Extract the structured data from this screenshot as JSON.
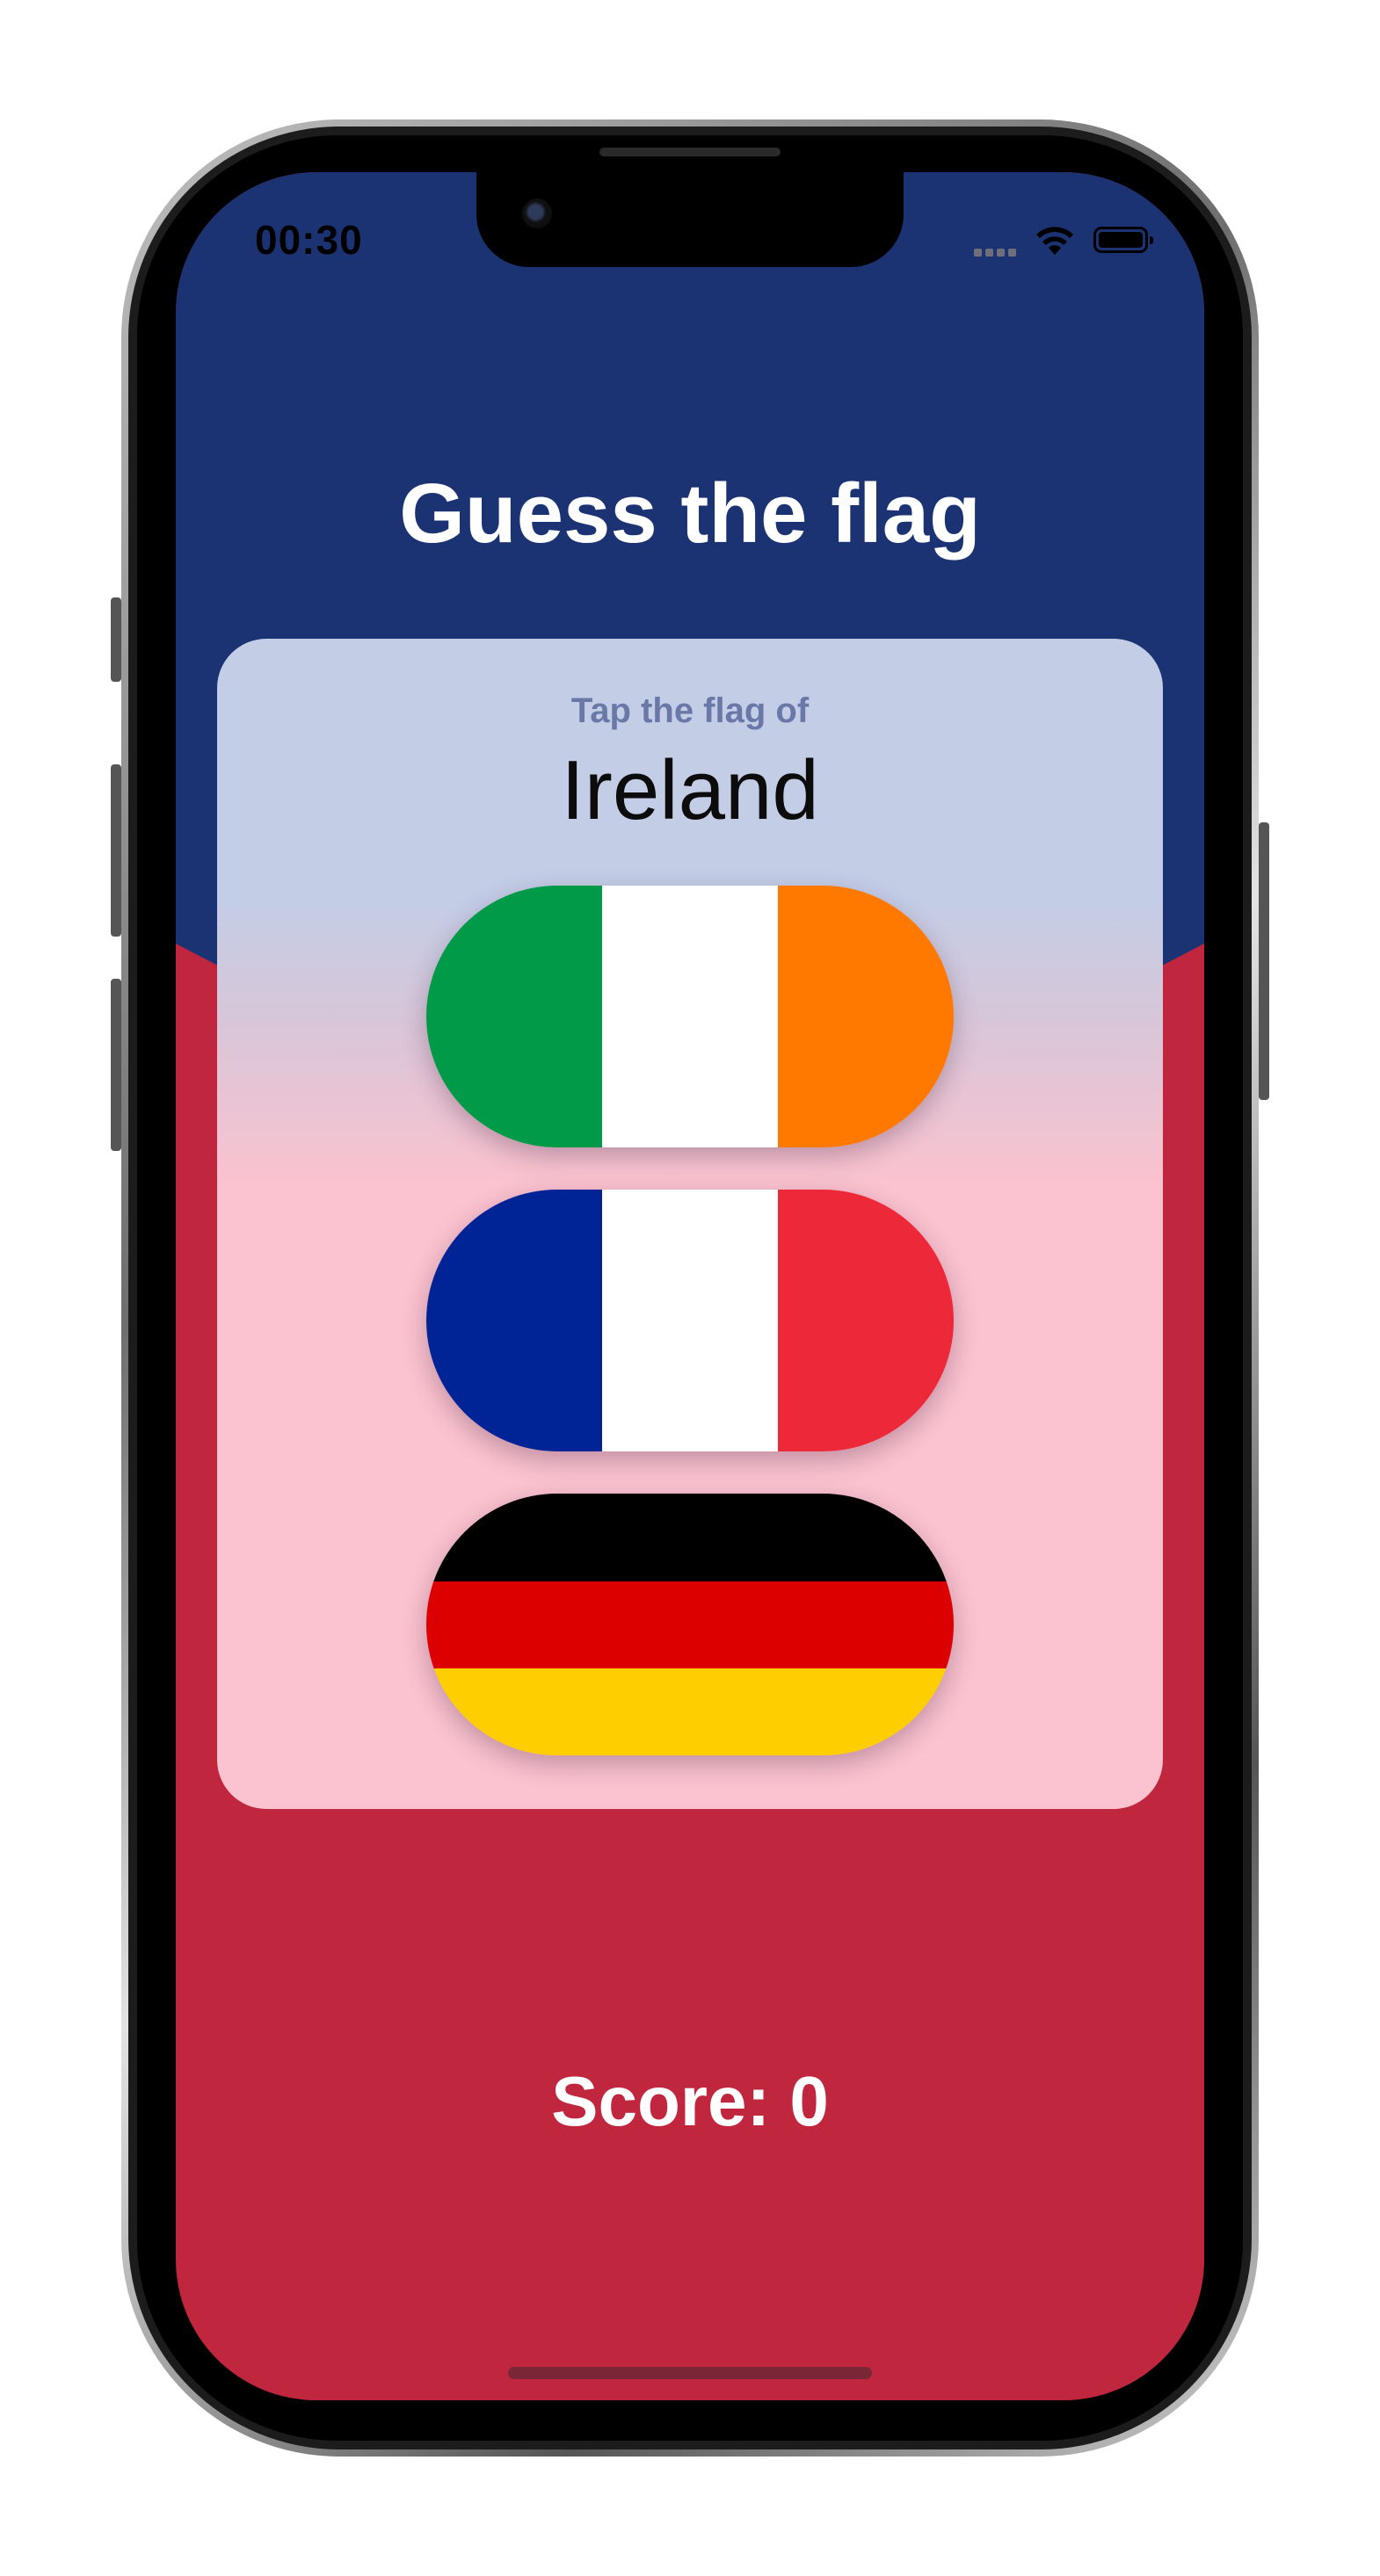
{
  "status_bar": {
    "time": "00:30",
    "icons": [
      "cellular-signal-icon",
      "wifi-icon",
      "battery-icon"
    ]
  },
  "app": {
    "title": "Guess the flag",
    "prompt": "Tap the flag of",
    "country": "Ireland",
    "score_text": "Score: 0"
  },
  "flags": [
    {
      "name": "Ireland",
      "orientation": "vertical",
      "colors": [
        "#009a49",
        "#ffffff",
        "#ff7900"
      ]
    },
    {
      "name": "France",
      "orientation": "vertical",
      "colors": [
        "#002395",
        "#ffffff",
        "#ed2939"
      ]
    },
    {
      "name": "Germany",
      "orientation": "horizontal",
      "colors": [
        "#000000",
        "#dd0000",
        "#ffce00"
      ]
    }
  ],
  "colors": {
    "top_background": "#1c3373",
    "bottom_background": "#c1263f",
    "card_top": "#c4cde6",
    "card_bottom": "#fbc2cf"
  }
}
